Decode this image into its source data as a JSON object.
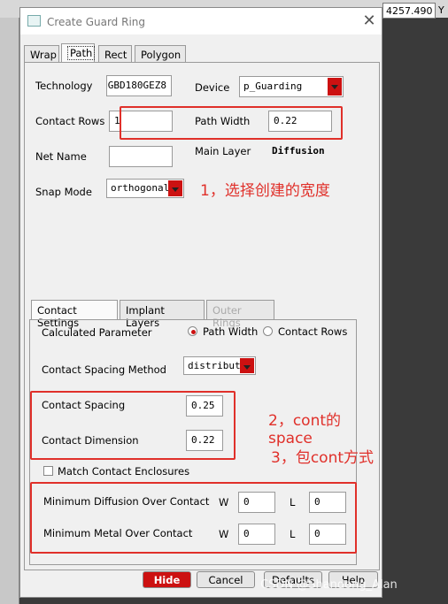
{
  "background": {
    "coord_value": "4257.490",
    "coord_axis": "Y"
  },
  "dialog": {
    "title": "Create Guard Ring",
    "tabs": [
      "Wrap",
      "Path",
      "Rect",
      "Polygon"
    ],
    "selected_tab": "Path",
    "technology_label": "Technology",
    "technology_value": "GBD180GEZ8",
    "device_label": "Device",
    "device_value": "p_Guarding",
    "contact_rows_label": "Contact Rows",
    "contact_rows_value": "1",
    "path_width_label": "Path Width",
    "path_width_value": "0.22",
    "net_name_label": "Net Name",
    "net_name_value": "",
    "main_layer_label": "Main Layer",
    "main_layer_value": "Diffusion",
    "snap_mode_label": "Snap Mode",
    "snap_mode_value": "orthogonal",
    "subtabs": [
      "Contact Settings",
      "Implant Layers",
      "Outer Rings"
    ],
    "calc_param_label": "Calculated Parameter",
    "calc_option_path_width": "Path Width",
    "calc_option_contact_rows": "Contact Rows",
    "calc_selected": "Path Width",
    "spacing_method_label": "Contact Spacing Method",
    "spacing_method_value": "distribute",
    "contact_spacing_label": "Contact Spacing",
    "contact_spacing_value": "0.25",
    "contact_dimension_label": "Contact Dimension",
    "contact_dimension_value": "0.22",
    "match_enclosures_label": "Match Contact Enclosures",
    "match_enclosures_checked": false,
    "min_diff_label": "Minimum Diffusion Over Contact",
    "min_metal_label": "Minimum Metal Over Contact",
    "w_label": "W",
    "l_label": "L",
    "min_diff_w": "0",
    "min_diff_l": "0",
    "min_metal_w": "0",
    "min_metal_l": "0",
    "buttons": {
      "hide": "Hide",
      "cancel": "Cancel",
      "defaults": "Defaults",
      "help": "Help"
    }
  },
  "annotations": {
    "note1": "1，选择创建的宽度",
    "note2": "2，cont的space",
    "note3": "3，包cont方式",
    "color": "#e0302a"
  },
  "watermark": "CSDN @Shandong_Alan"
}
